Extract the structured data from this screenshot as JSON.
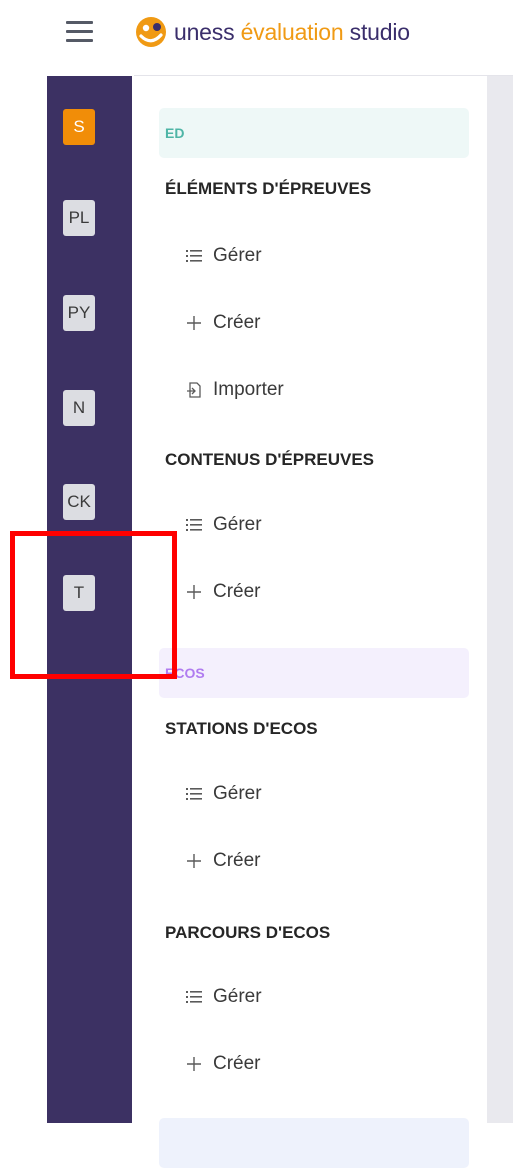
{
  "header": {
    "menu_icon": "hamburger-menu-icon",
    "logo_icon": "uness-logo-icon",
    "brand_part1": "uness",
    "brand_part2": "évaluation",
    "brand_part3": "studio",
    "brand_colors": {
      "primary": "#3a2e6b",
      "accent": "#f09a14"
    }
  },
  "rail": {
    "background": "#3c3163",
    "items": [
      {
        "label": "S",
        "active": true
      },
      {
        "label": "PL",
        "active": false
      },
      {
        "label": "PY",
        "active": false
      },
      {
        "label": "N",
        "active": false
      },
      {
        "label": "CK",
        "active": false
      },
      {
        "label": "T",
        "active": false
      }
    ]
  },
  "menu": {
    "sections": [
      {
        "tag": "ED",
        "tag_color": "#4eb5a6",
        "groups": [
          {
            "title": "ÉLÉMENTS D'ÉPREUVES",
            "items": [
              {
                "label": "Gérer",
                "icon": "list-icon"
              },
              {
                "label": "Créer",
                "icon": "plus-icon"
              },
              {
                "label": "Importer",
                "icon": "import-icon"
              }
            ]
          },
          {
            "title": "CONTENUS D'ÉPREUVES",
            "items": [
              {
                "label": "Gérer",
                "icon": "list-icon"
              },
              {
                "label": "Créer",
                "icon": "plus-icon"
              }
            ]
          }
        ]
      },
      {
        "tag": "ECOS",
        "tag_color": "#b07cf0",
        "groups": [
          {
            "title": "STATIONS D'ECOS",
            "items": [
              {
                "label": "Gérer",
                "icon": "list-icon"
              },
              {
                "label": "Créer",
                "icon": "plus-icon"
              }
            ]
          },
          {
            "title": "PARCOURS D'ECOS",
            "items": [
              {
                "label": "Gérer",
                "icon": "list-icon"
              },
              {
                "label": "Créer",
                "icon": "plus-icon"
              }
            ]
          }
        ]
      }
    ]
  },
  "annotation": {
    "highlight_color": "#ff0000",
    "highlighted_item": "T"
  }
}
